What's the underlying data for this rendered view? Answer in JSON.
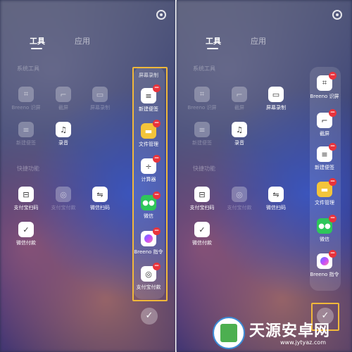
{
  "tabs": {
    "tools": "工具",
    "apps": "应用"
  },
  "sections": {
    "system_tools": "系统工具",
    "shortcuts": "快捷功能"
  },
  "left_panel": {
    "grid": [
      {
        "label": "Breeno 识屏",
        "icon": "scan-icon",
        "dim": true
      },
      {
        "label": "截屏",
        "icon": "crop-icon",
        "dim": true
      },
      {
        "label": "屏幕录制",
        "icon": "video-icon",
        "dim": true
      },
      {
        "label": "新建便签",
        "icon": "note-icon",
        "dim": true
      },
      {
        "label": "录音",
        "icon": "mic-icon",
        "dim": false
      },
      {
        "label": "支付宝扫码",
        "icon": "scan-code-icon",
        "dim": false
      },
      {
        "label": "支付宝付款",
        "icon": "alipay-icon",
        "dim": true
      },
      {
        "label": "微信扫码",
        "icon": "wechat-scan-icon",
        "dim": false
      },
      {
        "label": "微信付款",
        "icon": "wechat-pay-icon",
        "dim": false
      }
    ],
    "dock_title": "屏幕录制",
    "dock": [
      {
        "label": "新建便签",
        "icon": "note-icon"
      },
      {
        "label": "文件管理",
        "icon": "folder-icon"
      },
      {
        "label": "计算器",
        "icon": "calculator-icon"
      },
      {
        "label": "微信",
        "icon": "wechat-icon"
      },
      {
        "label": "Breeno 指令",
        "icon": "breeno-icon"
      },
      {
        "label": "支付宝付款",
        "icon": "alipay-icon"
      }
    ],
    "confirm": "✓"
  },
  "right_panel": {
    "grid": [
      {
        "label": "Breeno 识屏",
        "icon": "scan-icon",
        "dim": true
      },
      {
        "label": "截屏",
        "icon": "crop-icon",
        "dim": true
      },
      {
        "label": "屏幕录制",
        "icon": "video-icon",
        "dim": false
      },
      {
        "label": "新建便签",
        "icon": "note-icon",
        "dim": true
      },
      {
        "label": "录音",
        "icon": "mic-icon",
        "dim": false
      },
      {
        "label": "支付宝扫码",
        "icon": "scan-code-icon",
        "dim": false
      },
      {
        "label": "支付宝付款",
        "icon": "alipay-icon",
        "dim": true
      },
      {
        "label": "微信扫码",
        "icon": "wechat-scan-icon",
        "dim": false
      },
      {
        "label": "微信付款",
        "icon": "wechat-pay-icon",
        "dim": false
      }
    ],
    "dock": [
      {
        "label": "Breeno 识屏",
        "icon": "scan-icon"
      },
      {
        "label": "截屏",
        "icon": "crop-icon"
      },
      {
        "label": "新建便签",
        "icon": "note-icon"
      },
      {
        "label": "文件管理",
        "icon": "folder-icon"
      },
      {
        "label": "微信",
        "icon": "wechat-icon"
      },
      {
        "label": "Breeno 指令",
        "icon": "breeno-icon"
      }
    ]
  },
  "watermark": {
    "title": "天源安卓网",
    "url": "www.jytyaz.com"
  },
  "colors": {
    "highlight": "#f1b83a",
    "remove_badge": "#e8333c"
  }
}
